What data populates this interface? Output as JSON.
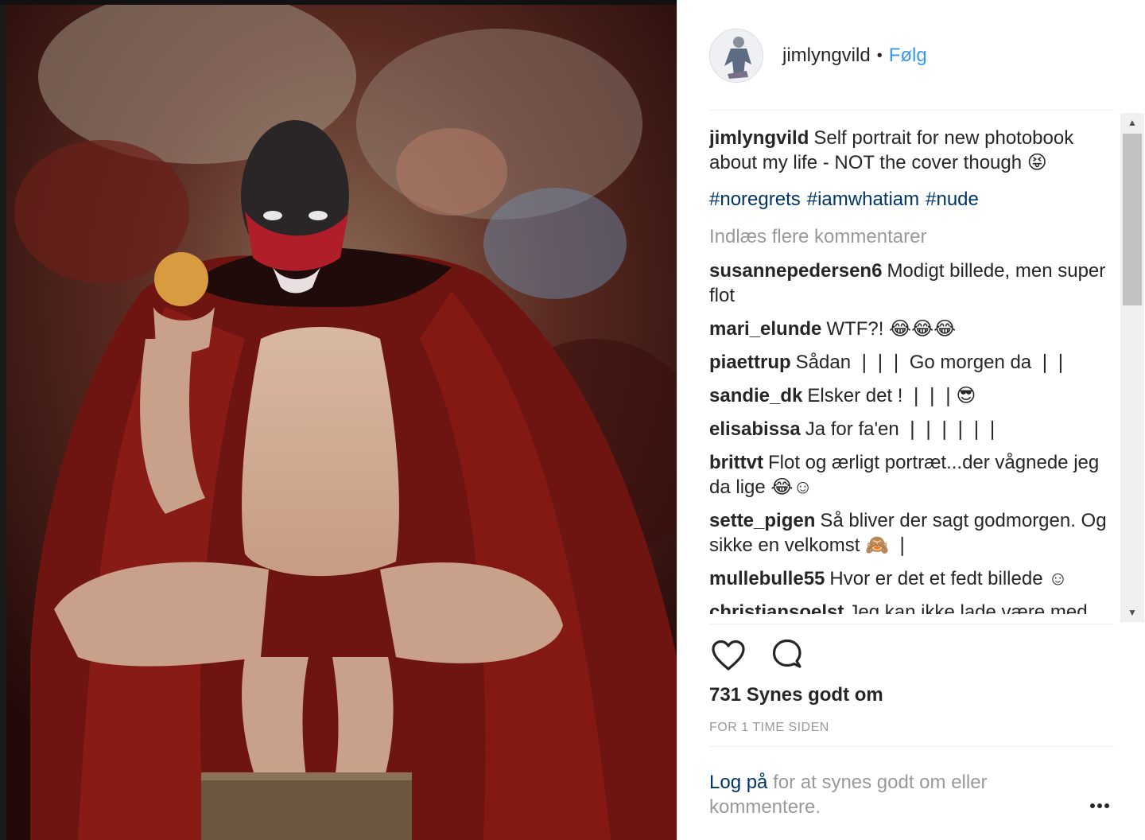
{
  "post": {
    "username": "jimlyngvild",
    "dot": "•",
    "follow_label": "Følg"
  },
  "caption": {
    "username": "jimlyngvild",
    "text": "Self portrait for new photobook about my life - NOT the cover though 😝",
    "hashtags": [
      "#noregrets",
      "#iamwhatiam",
      "#nude"
    ]
  },
  "load_more_label": "Indlæs flere kommentarer",
  "comments": [
    {
      "user": "susannepedersen6",
      "text": "Modigt billede, men super flot"
    },
    {
      "user": "mari_elunde",
      "text": "WTF?! 😂😂😂"
    },
    {
      "user": "piaettrup",
      "text": "Sådan ❘❘❘ Go morgen da ❘❘"
    },
    {
      "user": "sandie_dk",
      "text": "Elsker det ! ❘❘❘😎"
    },
    {
      "user": "elisabissa",
      "text": "Ja for fa'en ❘❘❘❘❘❘"
    },
    {
      "user": "brittvt",
      "text": "Flot og ærligt portræt...der vågnede jeg da lige 😂☺"
    },
    {
      "user": "sette_pigen",
      "text": "Så bliver der sagt godmorgen. Og sikke en velkomst 🙈 ❘"
    },
    {
      "user": "mullebulle55",
      "text": "Hvor er det et fedt billede ☺"
    },
    {
      "user": "christiansoelst",
      "text": "Jeg kan ikke lade være med"
    }
  ],
  "icons": {
    "like": "heart-icon",
    "comment": "comment-bubble-icon",
    "more": "more-options-icon"
  },
  "likes_text": "731 Synes godt om",
  "timestamp": "FOR 1 TIME SIDEN",
  "login": {
    "link": "Log på",
    "text": "for at synes godt om eller kommentere."
  },
  "scrollbar": {
    "up": "▲",
    "down": "▼"
  }
}
